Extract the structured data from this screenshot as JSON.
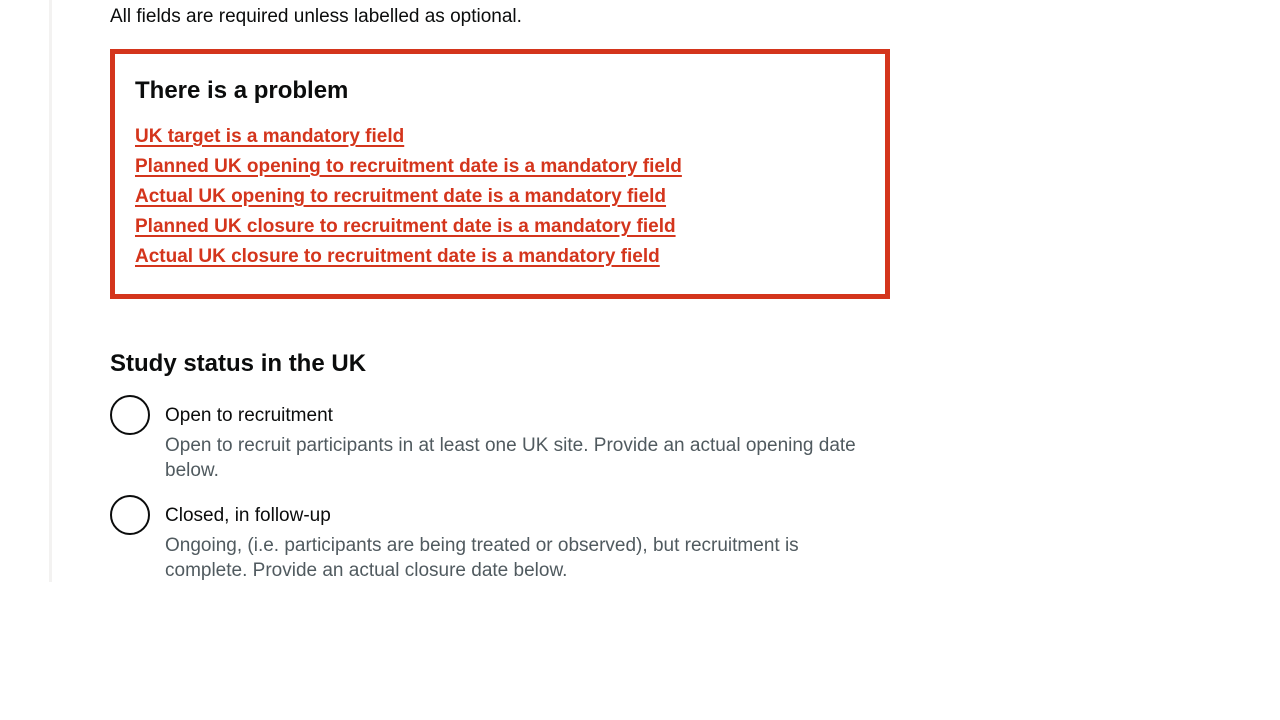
{
  "intro_text": "All fields are required unless labelled as optional.",
  "error_summary": {
    "title": "There is a problem",
    "errors": [
      "UK target is a mandatory field",
      "Planned UK opening to recruitment date is a mandatory field",
      "Actual UK opening to recruitment date is a mandatory field",
      "Planned UK closure to recruitment date is a mandatory field",
      "Actual UK closure to recruitment date is a mandatory field"
    ]
  },
  "study_status": {
    "legend": "Study status in the UK",
    "options": [
      {
        "label": "Open to recruitment",
        "hint": "Open to recruit participants in at least one UK site. Provide an actual opening date below."
      },
      {
        "label": "Closed, in follow-up",
        "hint": "Ongoing, (i.e. participants are being treated or observed), but recruitment is complete. Provide an actual closure date below."
      }
    ]
  },
  "colors": {
    "error": "#d4351c",
    "text": "#0b0c0c",
    "hint": "#505a5f"
  }
}
